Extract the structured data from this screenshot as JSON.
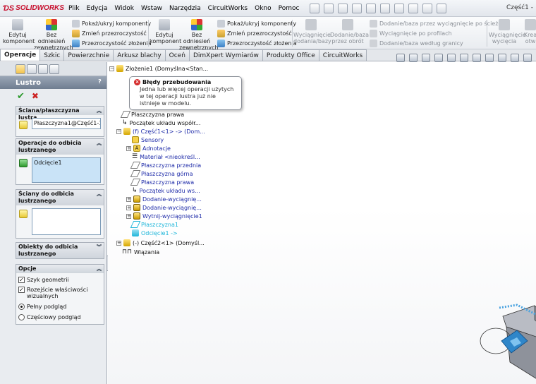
{
  "app": {
    "logo": "SOLIDWORKS",
    "window_title": "Część1 -"
  },
  "menu": [
    "Plik",
    "Edycja",
    "Widok",
    "Wstaw",
    "Narzędzia",
    "CircuitWorks",
    "Okno",
    "Pomoc"
  ],
  "commands": {
    "edit_component": "Edytuj komponent",
    "no_external_refs": "Bez odniesień zewnętrznych",
    "show_hide_components": "Pokaż/ukryj komponenty",
    "change_transparency": "Zmień przezroczystość",
    "assembly_transparency": "Przezroczystość złożenia",
    "extrude_boss": "Wyciągnięcie dodania/bazy",
    "revolve_boss": "Dodanie/baza przez obrót",
    "sweep_boss": "Dodanie/baza przez wyciągnięcie po ścieżce",
    "loft_extrude": "Wyciągnięcie po profilach",
    "boundary_boss": "Dodanie/baza według granicy",
    "extrude_cut": "Wyciągnięcie wycięcia",
    "sketch_partial": "Krea otw"
  },
  "tabs": [
    {
      "label": "Operacje",
      "active": true
    },
    {
      "label": "Szkic",
      "active": false
    },
    {
      "label": "Powierzchnie",
      "active": false
    },
    {
      "label": "Arkusz blachy",
      "active": false
    },
    {
      "label": "Oceń",
      "active": false
    },
    {
      "label": "DimXpert Wymiarów",
      "active": false
    },
    {
      "label": "Produkty Office",
      "active": false
    },
    {
      "label": "CircuitWorks",
      "active": false
    }
  ],
  "property_manager": {
    "title": "Lustro",
    "help": "?",
    "groups": {
      "mirror_plane": {
        "title": "Ściana/płaszczyzna lustra",
        "value": "Płaszczyzna1@Część1-1@Z"
      },
      "features_to_mirror": {
        "title": "Operacje do odbicia lustrzanego",
        "value": "Odcięcie1"
      },
      "faces_to_mirror": {
        "title": "Ściany do odbicia lustrzanego"
      },
      "bodies_to_mirror": {
        "title": "Obiekty do odbicia lustrzanego"
      },
      "options": {
        "title": "Opcje",
        "items": [
          {
            "type": "checkbox",
            "label": "Szyk geometrii",
            "checked": true
          },
          {
            "type": "checkbox",
            "label": "Rozejście właściwości wizualnych",
            "checked": true
          },
          {
            "type": "radio",
            "label": "Pełny podgląd",
            "checked": true
          },
          {
            "type": "radio",
            "label": "Częściowy podgląd",
            "checked": false
          }
        ]
      }
    }
  },
  "tree": {
    "root": "Złożenie1  (Domyślna<Stan...",
    "items": [
      "Płaszczyzna prawa",
      "Początek układu współr...",
      "(f) Część1<1> -> (Dom...",
      "Sensory",
      "Adnotacje",
      "Materiał <nieokreśl...",
      "Płaszczyzna przednia",
      "Płaszczyzna górna",
      "Płaszczyzna prawa",
      "Początek układu ws...",
      "Dodanie-wyciągnię...",
      "Dodanie-wyciągnię...",
      "Wytnij-wyciągnięcie1",
      "Płaszczyzna1",
      "Odcięcie1 ->",
      "(-) Część2<1> (Domyśl...",
      "Wiązania"
    ]
  },
  "tooltip": {
    "title": "Błędy przebudowania",
    "body": "Jedna lub więcej operacji użytych w tej operacji lustra już nie istnieje w modelu."
  }
}
